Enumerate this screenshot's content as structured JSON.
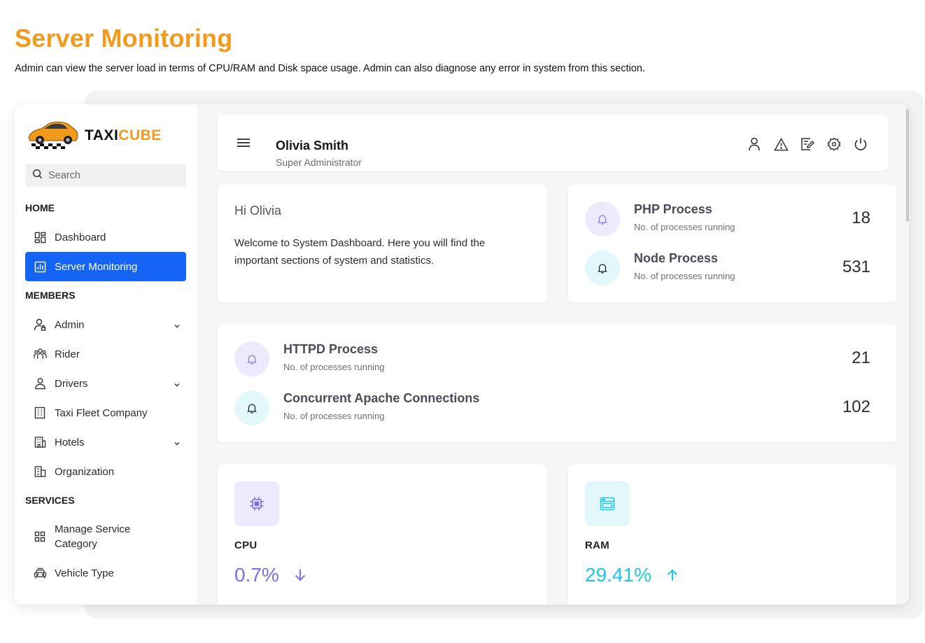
{
  "page": {
    "heading": "Server Monitoring",
    "description": "Admin can view the server load in terms of CPU/RAM and Disk space usage. Admin can also diagnose any error in system from this section."
  },
  "brand": {
    "name_part1": "TAXI",
    "name_part2": "CUBE",
    "icon": "taxi-car-logo"
  },
  "sidebar": {
    "search_placeholder": "Search",
    "sections": {
      "home": "HOME",
      "members": "MEMBERS",
      "services": "SERVICES"
    },
    "items": [
      {
        "label": "Dashboard",
        "icon": "dashboard-icon"
      },
      {
        "label": "Server Monitoring",
        "icon": "chart-icon",
        "active": true
      },
      {
        "label": "Admin",
        "icon": "admin-user-icon",
        "expandable": true
      },
      {
        "label": "Rider",
        "icon": "group-icon"
      },
      {
        "label": "Drivers",
        "icon": "driver-icon",
        "expandable": true
      },
      {
        "label": "Taxi Fleet Company",
        "icon": "building-icon"
      },
      {
        "label": "Hotels",
        "icon": "hotel-icon",
        "expandable": true
      },
      {
        "label": "Organization",
        "icon": "organization-icon"
      },
      {
        "label": "Manage Service Category",
        "icon": "grid-icon"
      },
      {
        "label": "Vehicle Type",
        "icon": "car-icon"
      }
    ]
  },
  "header": {
    "user_name": "Olivia Smith",
    "user_role": "Super Administrator",
    "icons": [
      "profile-icon",
      "alert-icon",
      "edit-icon",
      "settings-icon",
      "power-icon"
    ]
  },
  "welcome": {
    "greeting": "Hi Olivia",
    "text": "Welcome to System Dashboard. Here you will find the important sections of system and statistics."
  },
  "processes": [
    {
      "title": "PHP Process",
      "subtitle": "No. of processes running",
      "value": "18",
      "tone": "#eeeafd"
    },
    {
      "title": "Node Process",
      "subtitle": "No. of processes running",
      "value": "531",
      "tone": "#e2f8fb"
    },
    {
      "title": "HTTPD Process",
      "subtitle": "No. of processes running",
      "value": "21",
      "tone": "#eeeafd"
    },
    {
      "title": "Concurrent Apache Connections",
      "subtitle": "No. of processes running",
      "value": "102",
      "tone": "#e2f8fb"
    }
  ],
  "metrics": [
    {
      "label": "CPU",
      "value": "0.7%",
      "trend": "down",
      "color": "#7b6cf0",
      "icon": "cpu-icon"
    },
    {
      "label": "RAM",
      "value": "29.41%",
      "trend": "up",
      "color": "#1ec8e0",
      "icon": "ram-icon"
    }
  ],
  "colors": {
    "brand_orange": "#f29a1b",
    "active_blue": "#1664f4"
  }
}
